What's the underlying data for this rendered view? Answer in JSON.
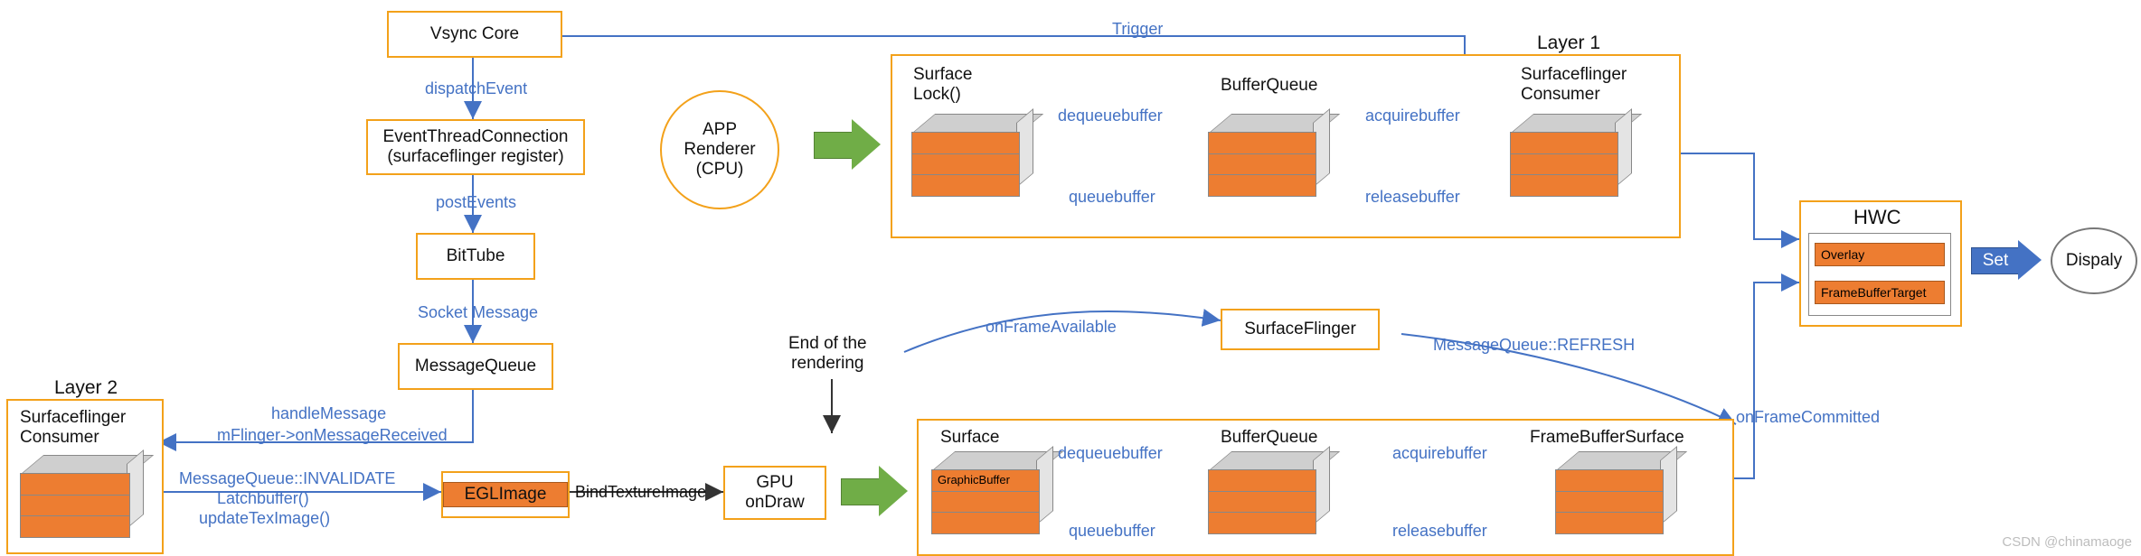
{
  "left_chain": {
    "vsync_core": "Vsync Core",
    "dispatch_event": "dispatchEvent",
    "event_thread_conn_l1": "EventThreadConnection",
    "event_thread_conn_l2": "(surfaceflinger register)",
    "post_events": "postEvents",
    "bittube": "BitTube",
    "socket_message": "Socket Message",
    "message_queue": "MessageQueue",
    "handle_message": "handleMessage",
    "on_message_received": "mFlinger->onMessageReceived",
    "mq_invalidate": "MessageQueue::INVALIDATE",
    "latch_buffer": "Latchbuffer()",
    "update_tex_image": "updateTexImage()"
  },
  "layer2": {
    "title": "Layer 2",
    "consumer_l1": "Surfaceflinger",
    "consumer_l2": "Consumer"
  },
  "eglimage": "EGLImage",
  "bind_texture_image": "BindTextureImage",
  "gpu_ondraw_l1": "GPU",
  "gpu_ondraw_l2": "onDraw",
  "app_renderer_l1": "APP",
  "app_renderer_l2": "Renderer",
  "app_renderer_l3": "(CPU)",
  "row1": {
    "title": "Layer 1",
    "surface_l1": "Surface",
    "surface_l2": "Lock()",
    "bufferqueue": "BufferQueue",
    "consumer_l1": "Surfaceflinger",
    "consumer_l2": "Consumer",
    "dequeuebuffer": "dequeuebuffer",
    "queuebuffer": "queuebuffer",
    "acquirebuffer": "acquirebuffer",
    "releasebuffer": "releasebuffer"
  },
  "trigger": "Trigger",
  "mid": {
    "end_rendering_l1": "End of the",
    "end_rendering_l2": "rendering",
    "on_frame_available": "onFrameAvailable",
    "surfaceflinger": "SurfaceFlinger",
    "mq_refresh": "MessageQueue::REFRESH"
  },
  "row2": {
    "surface": "Surface",
    "graphicbuffer": "GraphicBuffer",
    "bufferqueue": "BufferQueue",
    "framebuffersurface": "FrameBufferSurface",
    "dequeuebuffer": "dequeuebuffer",
    "queuebuffer": "queuebuffer",
    "acquirebuffer": "acquirebuffer",
    "releasebuffer": "releasebuffer",
    "on_frame_committed": "onFrameCommitted"
  },
  "hwc": {
    "title": "HWC",
    "overlay": "Overlay",
    "framebuffer_target": "FrameBufferTarget"
  },
  "set": "Set",
  "display": "Dispaly",
  "watermark": "CSDN @chinamaoge"
}
